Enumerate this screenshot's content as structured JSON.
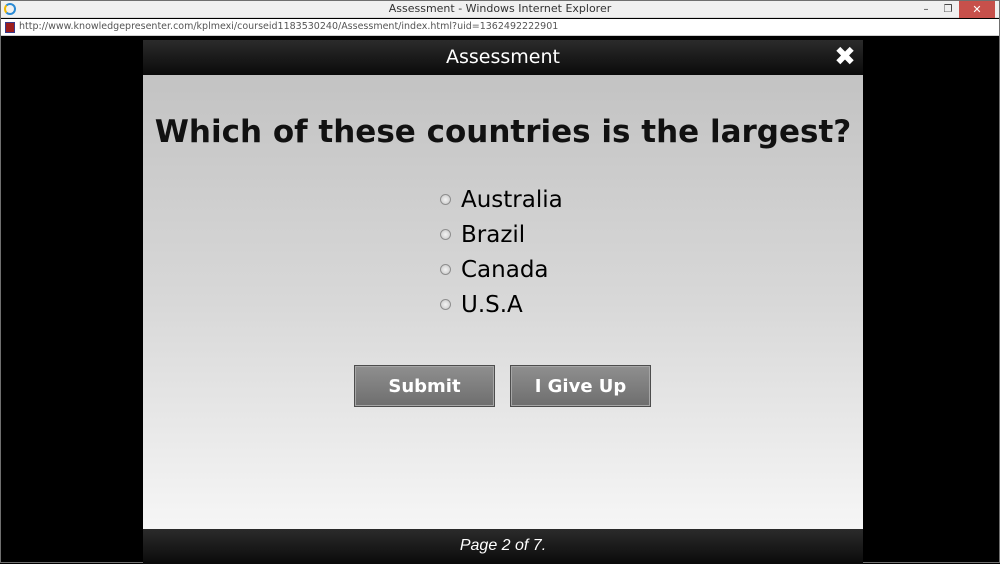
{
  "browser": {
    "window_title": "Assessment - Windows Internet Explorer",
    "url": "http://www.knowledgepresenter.com/kplmexi/courseid1183530240/Assessment/index.html?uid=1362492222901",
    "controls": {
      "minimize": "–",
      "restore": "❐",
      "close": "✕"
    }
  },
  "player": {
    "title": "Assessment",
    "close_symbol": "✖",
    "question": "Which of these countries is the largest?",
    "options": [
      "Australia",
      "Brazil",
      "Canada",
      "U.S.A"
    ],
    "buttons": {
      "submit": "Submit",
      "give_up": "I Give Up"
    },
    "page_indicator": "Page 2 of 7."
  }
}
